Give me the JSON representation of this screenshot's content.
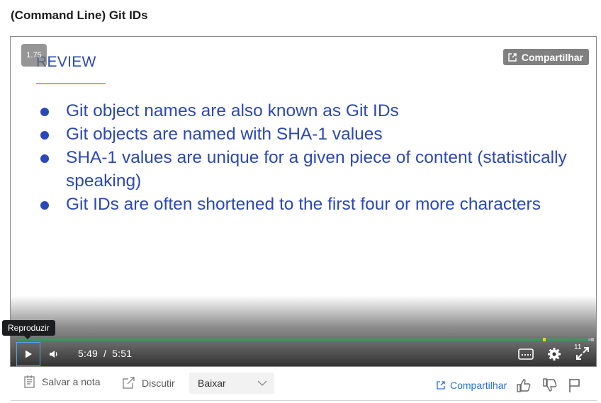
{
  "page": {
    "title": "(Command Line) Git IDs"
  },
  "slide": {
    "heading": "REVIEW",
    "bullets": [
      "Git object names are also known as Git IDs",
      "Git objects are named with SHA-1 values",
      "SHA-1 values are unique for a given piece of content (statistically speaking)",
      "Git IDs are often shortened to the first four or more characters"
    ]
  },
  "player": {
    "speed_label": "1.75",
    "share_label": "Compartilhar",
    "current_time": "5:49",
    "time_separator": "/",
    "duration": "5:51",
    "progress_fraction": 0.9943,
    "tooltip_play": "Reproduzir",
    "fullscreen_badge": "11",
    "colors": {
      "progress": "#2e9e5b",
      "marker": "#f2d600",
      "slide_text": "#2b48b8",
      "underline": "#f0a32a"
    },
    "icons": [
      "play-icon",
      "volume-icon",
      "captions-icon",
      "settings-gear-icon",
      "fullscreen-icon",
      "share-icon"
    ]
  },
  "actions": {
    "save_note_label": "Salvar a nota",
    "discuss_label": "Discutir",
    "download_label": "Baixar",
    "share_label": "Compartilhar",
    "icons": [
      "note-icon",
      "discuss-icon",
      "chevron-down-icon",
      "thumbs-up-icon",
      "thumbs-down-icon",
      "flag-icon"
    ]
  }
}
